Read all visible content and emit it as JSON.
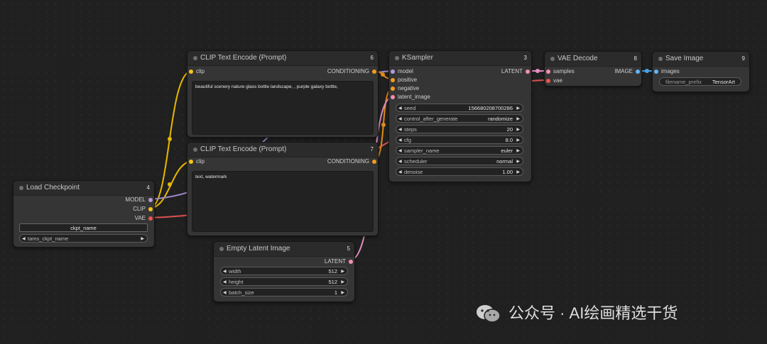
{
  "nodes": {
    "clip1": {
      "title": "CLIP Text Encode (Prompt)",
      "id": "6",
      "input_clip": "clip",
      "output": "CONDITIONING",
      "text": "beautiful scenery nature glass bottle landscape, , purple galaxy bottle,"
    },
    "clip2": {
      "title": "CLIP Text Encode (Prompt)",
      "id": "7",
      "input_clip": "clip",
      "output": "CONDITIONING",
      "text": "text, watermark"
    },
    "ksampler": {
      "title": "KSampler",
      "id": "3",
      "inputs": [
        "model",
        "positive",
        "negative",
        "latent_image"
      ],
      "output": "LATENT",
      "widgets": [
        {
          "label": "seed",
          "value": "156680208700286"
        },
        {
          "label": "control_after_generate",
          "value": "randomize"
        },
        {
          "label": "steps",
          "value": "20"
        },
        {
          "label": "cfg",
          "value": "8.0"
        },
        {
          "label": "sampler_name",
          "value": "euler"
        },
        {
          "label": "scheduler",
          "value": "normal"
        },
        {
          "label": "denoise",
          "value": "1.00"
        }
      ]
    },
    "vae": {
      "title": "VAE Decode",
      "id": "8",
      "inputs": [
        "samples",
        "vae"
      ],
      "output": "IMAGE"
    },
    "save": {
      "title": "Save Image",
      "id": "9",
      "input": "images",
      "widget_label": "filename_prefix",
      "widget_value": "TensorArt"
    },
    "loadckpt": {
      "title": "Load Checkpoint",
      "id": "4",
      "outputs": [
        "MODEL",
        "CLIP",
        "VAE"
      ],
      "ckpt_name": "ckpt_name",
      "widget_label": "tams_ckpt_name"
    },
    "latent": {
      "title": "Empty Latent Image",
      "id": "5",
      "output": "LATENT",
      "widgets": [
        {
          "label": "width",
          "value": "512"
        },
        {
          "label": "height",
          "value": "512"
        },
        {
          "label": "batch_size",
          "value": "1"
        }
      ]
    }
  },
  "colors": {
    "clip": "#f5c518",
    "conditioning": "#f39c1f",
    "model": "#b39ddb",
    "latent": "#f48fb1",
    "vae": "#ef5350",
    "image": "#64b5f6"
  },
  "watermark": "公众号 · AI绘画精选干货"
}
